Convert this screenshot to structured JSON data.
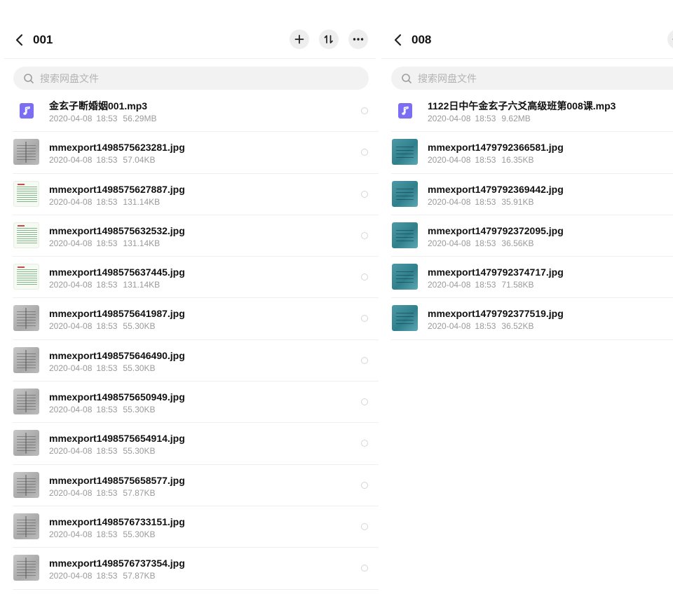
{
  "colors": {
    "accent": "#7c6ef2",
    "meta_text": "#9a9a9a",
    "button_bg": "#eeeeee"
  },
  "left": {
    "title": "001",
    "search_placeholder": "搜索网盘文件",
    "actions": [
      {
        "icon": "plus-icon",
        "name": "add-button"
      },
      {
        "icon": "sort-icon",
        "name": "sort-button"
      },
      {
        "icon": "more-icon",
        "name": "more-button"
      }
    ],
    "files": [
      {
        "name": "金玄子断婚姻001.mp3",
        "date": "2020-04-08",
        "time": "18:53",
        "size": "56.29MB",
        "thumb": "audio"
      },
      {
        "name": "mmexport1498575623281.jpg",
        "date": "2020-04-08",
        "time": "18:53",
        "size": "57.04KB",
        "thumb": "gray"
      },
      {
        "name": "mmexport1498575627887.jpg",
        "date": "2020-04-08",
        "time": "18:53",
        "size": "131.14KB",
        "thumb": "sheet"
      },
      {
        "name": "mmexport1498575632532.jpg",
        "date": "2020-04-08",
        "time": "18:53",
        "size": "131.14KB",
        "thumb": "sheet"
      },
      {
        "name": "mmexport1498575637445.jpg",
        "date": "2020-04-08",
        "time": "18:53",
        "size": "131.14KB",
        "thumb": "sheet"
      },
      {
        "name": "mmexport1498575641987.jpg",
        "date": "2020-04-08",
        "time": "18:53",
        "size": "55.30KB",
        "thumb": "gray"
      },
      {
        "name": "mmexport1498575646490.jpg",
        "date": "2020-04-08",
        "time": "18:53",
        "size": "55.30KB",
        "thumb": "gray"
      },
      {
        "name": "mmexport1498575650949.jpg",
        "date": "2020-04-08",
        "time": "18:53",
        "size": "55.30KB",
        "thumb": "gray"
      },
      {
        "name": "mmexport1498575654914.jpg",
        "date": "2020-04-08",
        "time": "18:53",
        "size": "55.30KB",
        "thumb": "gray"
      },
      {
        "name": "mmexport1498575658577.jpg",
        "date": "2020-04-08",
        "time": "18:53",
        "size": "57.87KB",
        "thumb": "gray"
      },
      {
        "name": "mmexport1498576733151.jpg",
        "date": "2020-04-08",
        "time": "18:53",
        "size": "55.30KB",
        "thumb": "gray"
      },
      {
        "name": "mmexport1498576737354.jpg",
        "date": "2020-04-08",
        "time": "18:53",
        "size": "57.87KB",
        "thumb": "gray"
      }
    ]
  },
  "right": {
    "title": "008",
    "search_placeholder": "搜索网盘文件",
    "files": [
      {
        "name": "1122日中午金玄子六爻高级班第008课.mp3",
        "date": "2020-04-08",
        "time": "18:53",
        "size": "9.62MB",
        "thumb": "audio"
      },
      {
        "name": "mmexport1479792366581.jpg",
        "date": "2020-04-08",
        "time": "18:53",
        "size": "16.35KB",
        "thumb": "teal"
      },
      {
        "name": "mmexport1479792369442.jpg",
        "date": "2020-04-08",
        "time": "18:53",
        "size": "35.91KB",
        "thumb": "teal"
      },
      {
        "name": "mmexport1479792372095.jpg",
        "date": "2020-04-08",
        "time": "18:53",
        "size": "36.56KB",
        "thumb": "teal"
      },
      {
        "name": "mmexport1479792374717.jpg",
        "date": "2020-04-08",
        "time": "18:53",
        "size": "71.58KB",
        "thumb": "teal"
      },
      {
        "name": "mmexport1479792377519.jpg",
        "date": "2020-04-08",
        "time": "18:53",
        "size": "36.52KB",
        "thumb": "teal"
      }
    ]
  }
}
